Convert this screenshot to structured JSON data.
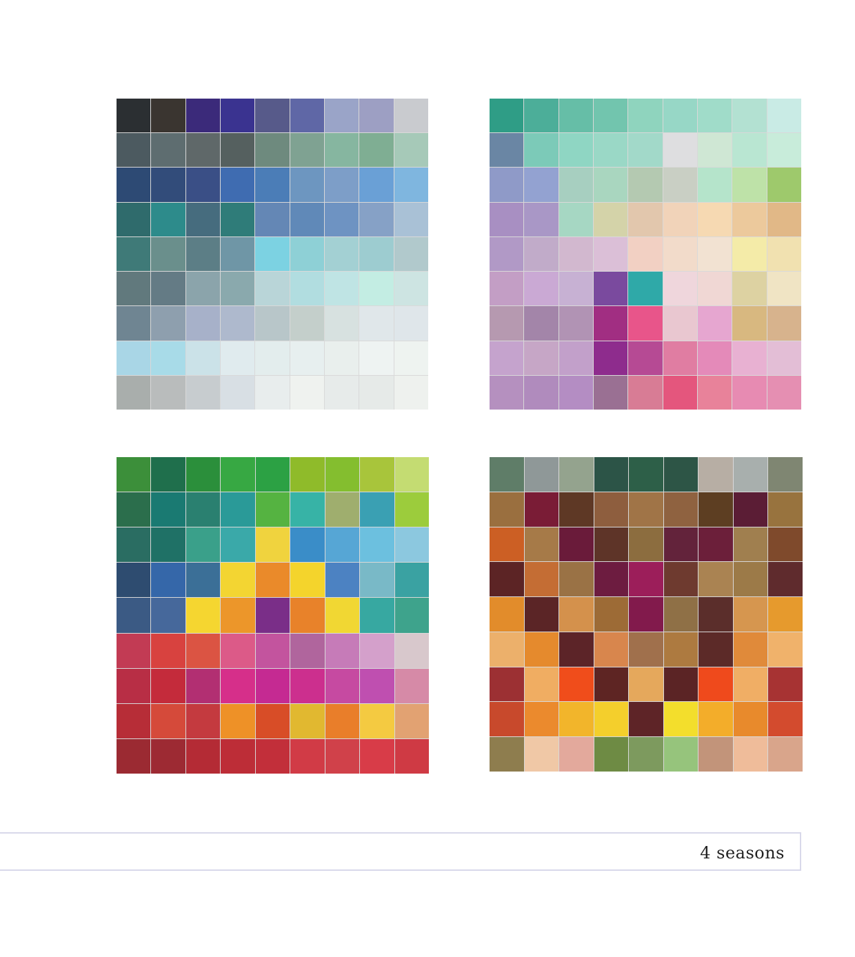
{
  "caption": "4 seasons",
  "mosaics": {
    "winter": [
      [
        "#2b2f32",
        "#3a3530",
        "#3b2a7a",
        "#3a3390",
        "#575a8a",
        "#5f67a6",
        "#9aa4c8",
        "#9d9fc3",
        "#c9cbcf"
      ],
      [
        "#4c5a60",
        "#5e6d70",
        "#5f6869",
        "#55605f",
        "#6e8a7e",
        "#7fa292",
        "#86b6a0",
        "#7fae93",
        "#a6c9b8"
      ],
      [
        "#2d4a74",
        "#324c7a",
        "#3a4f86",
        "#3f6cb1",
        "#4b7db7",
        "#6d96c0",
        "#7d9ec8",
        "#6aa0d6",
        "#7fb6df"
      ],
      [
        "#2f6b6c",
        "#2d8b8b",
        "#466c7e",
        "#2f7c79",
        "#6487b5",
        "#6089b8",
        "#6e93c2",
        "#86a1c6",
        "#a9c1d6"
      ],
      [
        "#3f7a78",
        "#6a8f8c",
        "#5c7e86",
        "#6f96a6",
        "#7cd2e2",
        "#8ed0d6",
        "#a3d0d3",
        "#9dccd0",
        "#b1c9cc"
      ],
      [
        "#61797d",
        "#647b85",
        "#8ba4ab",
        "#8aa9ad",
        "#b9d5d8",
        "#b1dde0",
        "#bfe4e4",
        "#c3ede3",
        "#cde4e2"
      ],
      [
        "#6f8592",
        "#8e9fae",
        "#a7b1c9",
        "#aeb9cd",
        "#b8c6c9",
        "#c4cfcb",
        "#d7e1e0",
        "#e0e7ea",
        "#dfe6ea"
      ],
      [
        "#a9d6e6",
        "#a8dbe8",
        "#cbe2e8",
        "#e0ebee",
        "#e3eded",
        "#e7efef",
        "#e9efed",
        "#eef3f2",
        "#eef3f0"
      ],
      [
        "#a9aeac",
        "#b9bcbc",
        "#c7cccf",
        "#d8dfe4",
        "#e8eded",
        "#eff2ef",
        "#e7ebea",
        "#e6eae8",
        "#eef1ee"
      ]
    ],
    "spring": [
      [
        "#2f9d86",
        "#4cae99",
        "#66bea7",
        "#72c5ae",
        "#8fd4be",
        "#97d7c6",
        "#a0dcc9",
        "#b3e1d2",
        "#c9ebe5"
      ],
      [
        "#6a86a4",
        "#7ccab8",
        "#8fd6c3",
        "#9ad8c6",
        "#a2d9c9",
        "#dedee0",
        "#cfe7d4",
        "#b9e6d2",
        "#c8ecda"
      ],
      [
        "#8f9ac8",
        "#93a2d1",
        "#a7cfc0",
        "#a9d6bf",
        "#b4c9b1",
        "#c9cfc4",
        "#b5e4cb",
        "#bee2a8",
        "#9ec96c"
      ],
      [
        "#a88fc2",
        "#a997c6",
        "#a6d7c3",
        "#d4d3a9",
        "#e2c7ad",
        "#f1d3b9",
        "#f6d9b2",
        "#ecc99c",
        "#e1b887"
      ],
      [
        "#b199c6",
        "#c1abc9",
        "#d2b8cf",
        "#dbbfd7",
        "#f2d0c3",
        "#f2dbca",
        "#f2e2d2",
        "#f4eba8",
        "#f1e1b0"
      ],
      [
        "#c39ec5",
        "#caa9d4",
        "#c7b1d3",
        "#7a4a9e",
        "#2fa9a8",
        "#efd6dc",
        "#f0d7d4",
        "#ddd2a2",
        "#f0e4c4"
      ],
      [
        "#b699b0",
        "#a385a9",
        "#b193b4",
        "#a12e82",
        "#e8558a",
        "#e9c7d0",
        "#e6a6d0",
        "#d8b880",
        "#d7b38d"
      ],
      [
        "#c5a3cd",
        "#c6a6c6",
        "#c2a0ca",
        "#8e2c8d",
        "#b64a94",
        "#e07da2",
        "#e48ab9",
        "#e8b1d2",
        "#e3bed6"
      ],
      [
        "#b590bf",
        "#b08bbd",
        "#b48dc3",
        "#9a7093",
        "#d87c95",
        "#e4567d",
        "#e8829a",
        "#e78bb2",
        "#e58fb2"
      ]
    ],
    "summer": [
      [
        "#3c8f3a",
        "#1f6f4c",
        "#2b8f3b",
        "#37a843",
        "#2ca144",
        "#8fbb2a",
        "#84be2f",
        "#a8c53b",
        "#c4dc72"
      ],
      [
        "#2b6e4c",
        "#1a7a72",
        "#2a8070",
        "#2a9a98",
        "#55b341",
        "#37b3a6",
        "#9fae6e",
        "#3aa0b3",
        "#9ccc3c"
      ],
      [
        "#2a6d62",
        "#1f7166",
        "#3aa08a",
        "#3aa9a9",
        "#f0d33e",
        "#3a8dc8",
        "#56a6d5",
        "#6cc0df",
        "#8cc8df"
      ],
      [
        "#2e4c70",
        "#3567a9",
        "#3b6f97",
        "#f3d532",
        "#ea8a2a",
        "#f4d42c",
        "#4c82c2",
        "#79b9c7",
        "#3aa2a2"
      ],
      [
        "#3b5a84",
        "#46689b",
        "#f5d630",
        "#ec962a",
        "#7a2e88",
        "#e8822a",
        "#f1d733",
        "#37a8a1",
        "#3ea38c"
      ],
      [
        "#c23b54",
        "#d8423f",
        "#db5443",
        "#dc5a88",
        "#c3549e",
        "#b0659d",
        "#c67bb8",
        "#d4a0cb",
        "#d8c8cc"
      ],
      [
        "#b82e45",
        "#c42b3b",
        "#b22f72",
        "#d62f8a",
        "#c52a92",
        "#cc2f8e",
        "#c64aa1",
        "#bf4fb0",
        "#d68aa7"
      ],
      [
        "#b72d37",
        "#d54a3a",
        "#c43a3f",
        "#ee9127",
        "#d84d27",
        "#e1b830",
        "#e97e2a",
        "#f4ca41",
        "#e2a272"
      ],
      [
        "#9b2a32",
        "#9d2a33",
        "#b42b35",
        "#bd2d37",
        "#c22f3a",
        "#d13b46",
        "#d0414a",
        "#d83c48",
        "#cf3a44"
      ]
    ],
    "autumn": [
      [
        "#5f7d68",
        "#8f9898",
        "#94a38e",
        "#2c5447",
        "#2d5f48",
        "#2d5546",
        "#b7aea4",
        "#a8afad",
        "#7f8672"
      ],
      [
        "#9a6f3f",
        "#7a1c36",
        "#5e3825",
        "#8e5e3e",
        "#a07447",
        "#8f6240",
        "#5d3e22",
        "#5b1d35",
        "#98733e"
      ],
      [
        "#cc5f24",
        "#a67a48",
        "#6a1b3a",
        "#5e3428",
        "#8c6d3f",
        "#63233b",
        "#6c1f3a",
        "#a07f4f",
        "#7f4a2c"
      ],
      [
        "#5c2425",
        "#c46d34",
        "#9a7245",
        "#6d1c40",
        "#9c1e5a",
        "#6e3a2f",
        "#aa8352",
        "#9c7a48",
        "#5f2b2d"
      ],
      [
        "#e28c2b",
        "#5b2526",
        "#d4914c",
        "#9d6b36",
        "#821a4c",
        "#8f7046",
        "#5b2e2b",
        "#d6964f",
        "#e69a2d"
      ],
      [
        "#ecb06b",
        "#e58a2d",
        "#5c2428",
        "#d8864d",
        "#a0704c",
        "#ad7a40",
        "#5c2a28",
        "#e08a3a",
        "#f0b26b"
      ],
      [
        "#9c3033",
        "#f0ad62",
        "#f04d1b",
        "#5e2523",
        "#e5a85c",
        "#5b2425",
        "#ef4a1c",
        "#f0ae65",
        "#a73333"
      ],
      [
        "#c8492c",
        "#eb8a2d",
        "#f2b52b",
        "#f4cf2c",
        "#5e2427",
        "#f3de2c",
        "#f3ad2a",
        "#e88a2c",
        "#d34b2e"
      ],
      [
        "#8e7d4e",
        "#f0c8a6",
        "#e3a99c",
        "#6e8b44",
        "#7d9a5e",
        "#96c47c",
        "#c2947a",
        "#efbc9a",
        "#d9a58b"
      ]
    ]
  }
}
